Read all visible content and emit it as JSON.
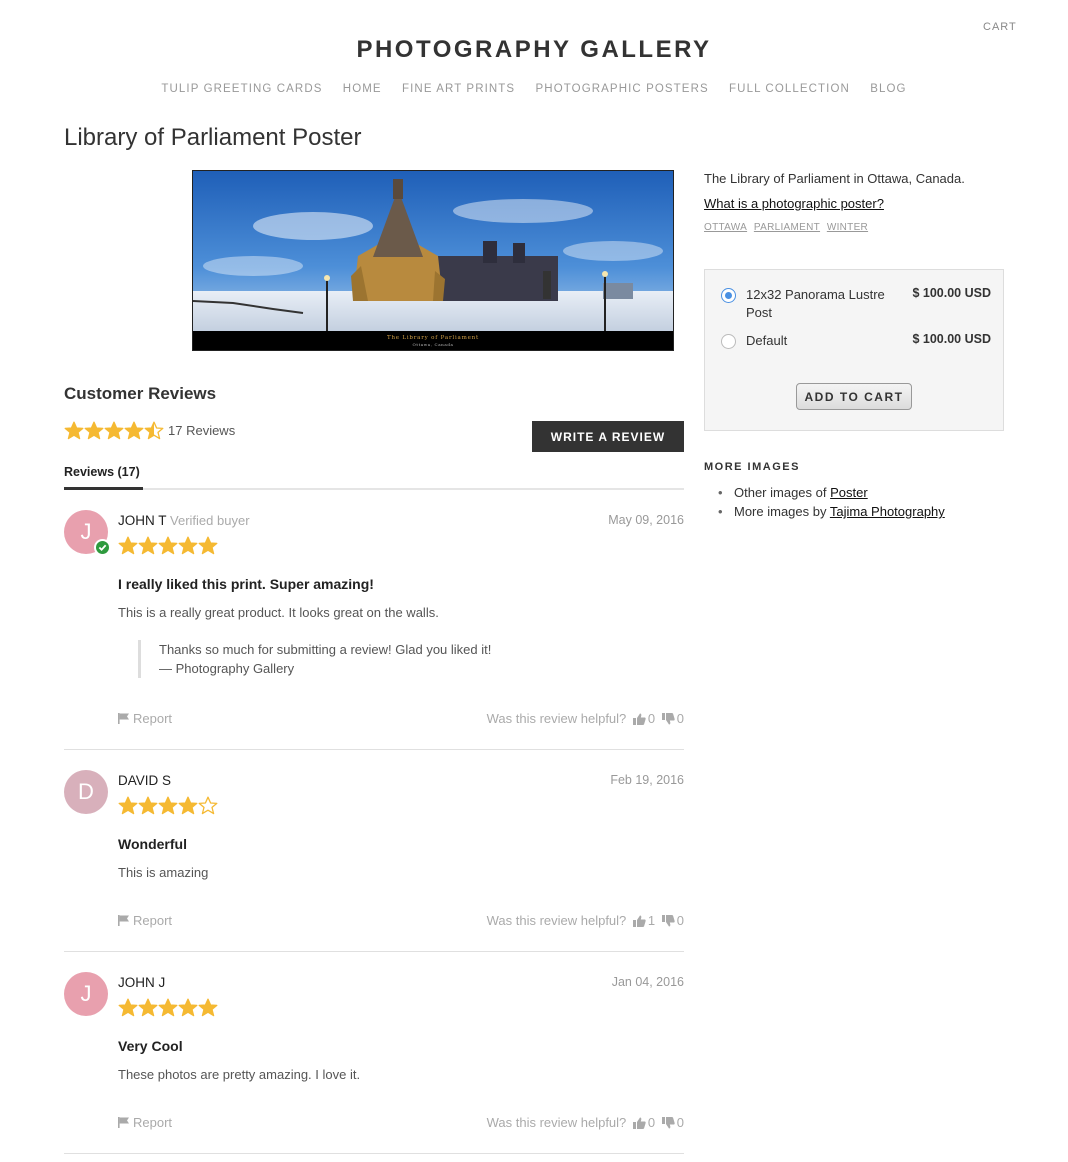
{
  "header": {
    "cart_label": "CART",
    "site_title": "PHOTOGRAPHY GALLERY",
    "nav": [
      "TULIP GREETING CARDS",
      "HOME",
      "FINE ART PRINTS",
      "PHOTOGRAPHIC POSTERS",
      "FULL COLLECTION",
      "BLOG"
    ]
  },
  "product": {
    "title": "Library of Parliament Poster",
    "image_caption_line1": "The Library of Parliament",
    "image_caption_line2": "Ottawa, Canada",
    "description": "The Library of Parliament in Ottawa, Canada.",
    "info_link": "What is a photographic poster?",
    "tags": [
      "OTTAWA",
      "PARLIAMENT",
      "WINTER"
    ],
    "variants": [
      {
        "label": "12x32 Panorama Lustre Post",
        "price": "$ 100.00 USD",
        "selected": true
      },
      {
        "label": "Default",
        "price": "$ 100.00 USD",
        "selected": false
      }
    ],
    "add_to_cart_label": "ADD TO CART"
  },
  "more_images": {
    "heading": "MORE IMAGES",
    "item1_prefix": "Other images of",
    "item1_link": "Poster",
    "item2_prefix": "More images by",
    "item2_link": "Tajima Photography"
  },
  "reviews": {
    "heading": "Customer Reviews",
    "average_rating": 4.5,
    "count_text": "17 Reviews",
    "write_review_label": "WRITE A REVIEW",
    "tab_label": "Reviews (17)",
    "report_label": "Report",
    "helpful_label": "Was this review helpful?",
    "colors": {
      "star": "#f5b932",
      "avatar_pink": "#e8a0ae",
      "avatar_mauve": "#d8b0bb"
    },
    "items": [
      {
        "initial": "J",
        "name": "JOHN T",
        "verified_label": "Verified buyer",
        "date": "May 09, 2016",
        "rating": 5,
        "title": "I really liked this print. Super amazing!",
        "body": "This is a really great product. It looks great on the walls.",
        "reply_text": "Thanks so much for submitting a review! Glad you liked it!",
        "reply_author": "— Photography Gallery",
        "helpful_up": "0",
        "helpful_down": "0"
      },
      {
        "initial": "D",
        "name": "DAVID S",
        "date": "Feb 19, 2016",
        "rating": 4,
        "title": "Wonderful",
        "body": "This is amazing",
        "helpful_up": "1",
        "helpful_down": "0"
      },
      {
        "initial": "J",
        "name": "JOHN J",
        "date": "Jan 04, 2016",
        "rating": 5,
        "title": "Very Cool",
        "body": "These photos are pretty amazing. I love it.",
        "helpful_up": "0",
        "helpful_down": "0"
      }
    ]
  }
}
